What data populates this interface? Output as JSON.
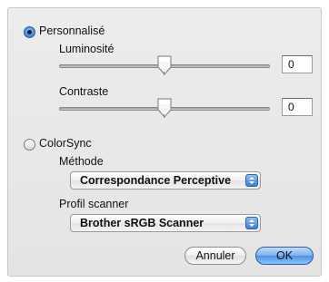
{
  "personal": {
    "label": "Personnalisé",
    "selected": true,
    "brightness": {
      "label": "Luminosité",
      "value": "0",
      "slider_fraction": 0.5
    },
    "contrast": {
      "label": "Contraste",
      "value": "0",
      "slider_fraction": 0.5
    }
  },
  "colorsync": {
    "label": "ColorSync",
    "selected": false,
    "method": {
      "label": "Méthode",
      "value": "Correspondance Perceptive"
    },
    "profile": {
      "label": "Profil scanner",
      "value": "Brother sRGB Scanner"
    }
  },
  "buttons": {
    "cancel": "Annuler",
    "ok": "OK"
  },
  "colors": {
    "accent": "#4f8fdc",
    "panel": "#e8e8e8"
  }
}
